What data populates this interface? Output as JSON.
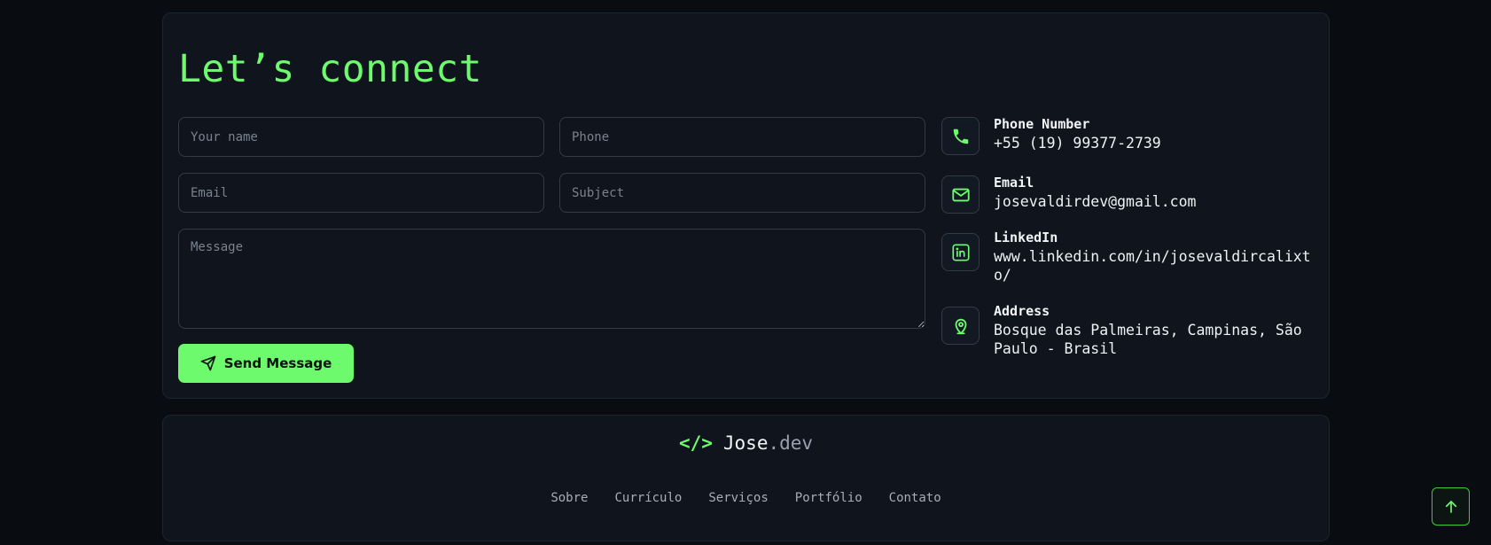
{
  "contact": {
    "title": "Let’s connect",
    "form": {
      "name_placeholder": "Your name",
      "phone_placeholder": "Phone",
      "email_placeholder": "Email",
      "subject_placeholder": "Subject",
      "message_placeholder": "Message",
      "name_value": "",
      "phone_value": "",
      "email_value": "",
      "subject_value": "",
      "message_value": "",
      "send_label": "Send Message",
      "send_icon": "send-icon"
    },
    "info": {
      "phone": {
        "label": "Phone Number",
        "value": "+55 (19) 99377-2739",
        "icon": "phone-icon"
      },
      "email": {
        "label": "Email",
        "value": "josevaldirdev@gmail.com",
        "icon": "mail-icon"
      },
      "linkedin": {
        "label": "LinkedIn",
        "value": "www.linkedin.com/in/josevaldircalixto/",
        "icon": "linkedin-icon"
      },
      "address": {
        "label": "Address",
        "value": "Bosque das Palmeiras, Campinas, São Paulo - Brasil",
        "icon": "map-pin-icon"
      }
    }
  },
  "footer": {
    "brand": {
      "symbol": "</>",
      "name": "Jose",
      "suffix": ".dev"
    },
    "nav": [
      "Sobre",
      "Currículo",
      "Serviços",
      "Portfólio",
      "Contato"
    ]
  },
  "scroll_top": {
    "icon": "arrow-up-icon"
  },
  "colors": {
    "accent": "#6dfb6d",
    "background": "#090c11",
    "card": "#0f141d",
    "border": "#333b46"
  }
}
